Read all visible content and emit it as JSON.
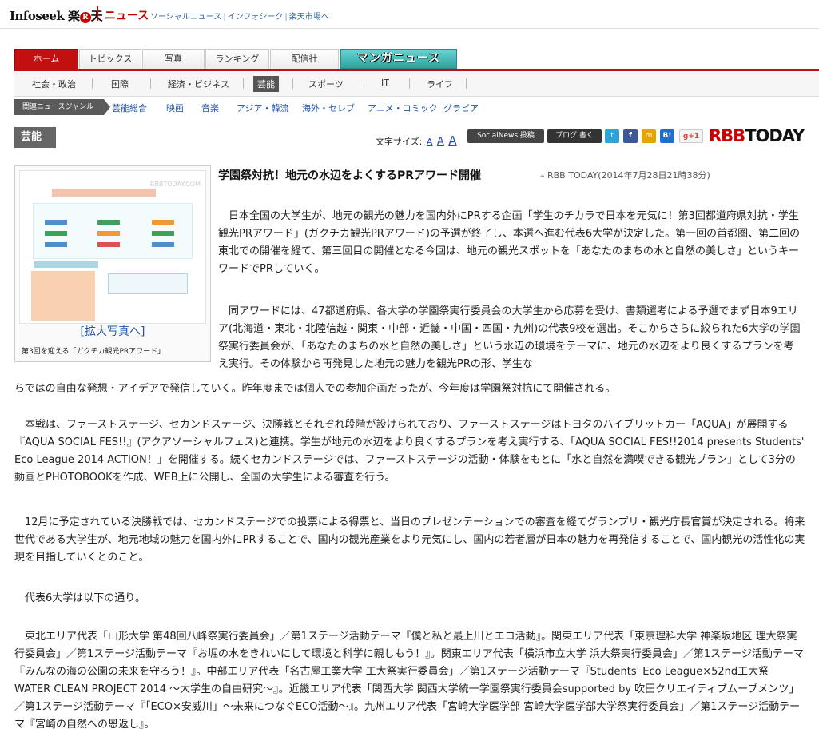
{
  "topbar": {
    "logo_infoseek": "Infoseek",
    "logo_raku": "楽",
    "logo_mark": "",
    "logo_ten": "天",
    "news_label": "ニュース",
    "links": [
      "ソーシャルニュース",
      "インフォシーク",
      "楽天市場へ"
    ]
  },
  "tabs": [
    {
      "label": "ホーム",
      "active": true
    },
    {
      "label": "トピックス"
    },
    {
      "label": "写真"
    },
    {
      "label": "ランキング"
    },
    {
      "label": "配信社"
    }
  ],
  "manga_label": "マンガニュース",
  "subnav": [
    "社会・政治",
    "国際",
    "経済・ビジネス",
    "芸能",
    "スポーツ",
    "IT",
    "ライフ"
  ],
  "subnav_active": "芸能",
  "genre": {
    "label": "関連ニュースジャンル",
    "items": [
      "芸能総合",
      "映画",
      "音楽",
      "アジア・韓流",
      "海外・セレブ",
      "アニメ・コミック",
      "グラビア"
    ]
  },
  "section_title": "芸能",
  "font_size_label": "文字サイズ:",
  "font_size_options": [
    "A",
    "A",
    "A"
  ],
  "share": {
    "socialnews": "SocialNews 投稿",
    "blog": "ブログ 書く",
    "twitter": "",
    "facebook": "f",
    "mixi": "",
    "hatena": "B!",
    "gplus": "g+1"
  },
  "brand": {
    "r": "RBB",
    "t": "TODAY"
  },
  "figure": {
    "thumb_brand": "RBBTODAY.COM",
    "enlarge": "[拡大写真へ]",
    "caption": "第3回を迎える「ガクチカ観光PRアワード」"
  },
  "article": {
    "headline": "学園祭対抗！地元の水辺をよくするPRアワード開催",
    "credit": "– RBB TODAY(2014年7月28日21時38分)",
    "p1": "　日本全国の大学生が、地元の観光の魅力を国内外にPRする企画「学生のチカラで日本を元気に！第3回都道府県対抗・学生観光PRアワード」(ガクチカ観光PRアワード)の予選が終了し、本選へ進む代表6大学が決定した。第一回の首都圏、第二回の東北での開催を経て、第三回目の開催となる今回は、地元の観光スポットを「あなたのまちの水と自然の美しさ」というキーワードでPRしていく。",
    "p2a": "　同アワードには、47都道府県、各大学の学園祭実行委員会の大学生から応募を受け、書類選考による予選でまず日本9エリア(北海道・東北・北陸信越・関東・中部・近畿・中国・四国・九州)の代表9校を選出。そこからさらに絞られた6大学の学園祭実行委員会が、「あなたのまちの水と自然の美しさ」という水辺の環境をテーマに、地元の水辺をより良くするプランを考え実行。その体験から再発見した地元の魅力を観光PRの形、学生な",
    "p2b": "らではの自由な発想・アイデアで発信していく。昨年度までは個人での参加企画だったが、今年度は学園祭対抗にて開催される。",
    "p3": "　本戦は、ファーストステージ、セカンドステージ、決勝戦とそれぞれ段階が設けられており、ファーストステージはトヨタのハイブリットカー「AQUA」が展開する『AQUA SOCIAL FES!!』(アクアソーシャルフェス)と連携。学生が地元の水辺をより良くするプランを考え実行する、「AQUA SOCIAL FES!!2014 presents Students' Eco League 2014 ACTION！」を開催する。続くセカンドステージでは、ファーストステージの活動・体験をもとに「水と自然を満喫できる観光プラン」として3分の動画とPHOTOBOOKを作成、WEB上に公開し、全国の大学生による審査を行う。",
    "p4": "　12月に予定されている決勝戦では、セカンドステージでの投票による得票と、当日のプレゼンテーションでの審査を経てグランプリ・観光庁長官賞が決定される。将来世代である大学生が、地元地域の魅力を国内外にPRすることで、国内の観光産業をより元気にし、国内の若者層が日本の魅力を再発信することで、国内観光の活性化の実現を目指していくとのこと。",
    "p5": "　代表6大学は以下の通り。",
    "p6": "　東北エリア代表「山形大学 第48回八峰祭実行委員会」／第1ステージ活動テーマ『僕と私と最上川とエコ活動』。関東エリア代表「東京理科大学 神楽坂地区 理大祭実行委員会」／第1ステージ活動テーマ『お堀の水をきれいにして環境と科学に親しもう！』。関東エリア代表「横浜市立大学 浜大祭実行委員会」／第1ステージ活動テーマ『みんなの海の公園の未来を守ろう！』。中部エリア代表「名古屋工業大学 工大祭実行委員会」／第1ステージ活動テーマ『Students' Eco League×52nd工大祭 WATER CLEAN PROJECT 2014 ～大学生の自由研究～』。近畿エリア代表「関西大学 関西大学統一学園祭実行委員会supported by 吹田クリエイティブムーブメンツ」／第1ステージ活動テーマ『「ECO×安威川」～未来につなぐECO活動～』。九州エリア代表「宮崎大学医学部 宮崎大学医学部大学祭実行委員会」／第1ステージ活動テーマ『宮崎の自然への恩返し』。"
  }
}
